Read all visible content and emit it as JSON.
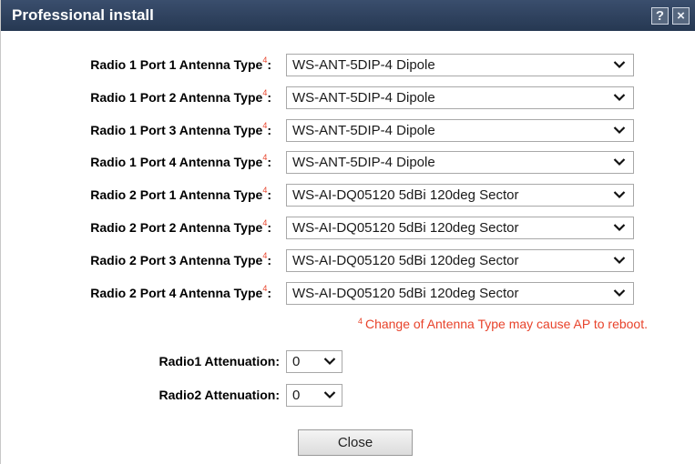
{
  "dialog": {
    "title": "Professional install",
    "help_glyph": "?",
    "close_glyph": "×"
  },
  "antenna_rows": [
    {
      "label": "Radio 1 Port 1 Antenna Type",
      "value": "WS-ANT-5DIP-4 Dipole"
    },
    {
      "label": "Radio 1 Port 2 Antenna Type",
      "value": "WS-ANT-5DIP-4 Dipole"
    },
    {
      "label": "Radio 1 Port 3 Antenna Type",
      "value": "WS-ANT-5DIP-4 Dipole"
    },
    {
      "label": "Radio 1 Port 4 Antenna Type",
      "value": "WS-ANT-5DIP-4 Dipole"
    },
    {
      "label": "Radio 2 Port 1 Antenna Type",
      "value": "WS-AI-DQ05120 5dBi 120deg Sector"
    },
    {
      "label": "Radio 2 Port 2 Antenna Type",
      "value": "WS-AI-DQ05120 5dBi 120deg Sector"
    },
    {
      "label": "Radio 2 Port 3 Antenna Type",
      "value": "WS-AI-DQ05120 5dBi 120deg Sector"
    },
    {
      "label": "Radio 2 Port 4 Antenna Type",
      "value": "WS-AI-DQ05120 5dBi 120deg Sector"
    }
  ],
  "footnote_marker": "4",
  "label_colon": ":",
  "note": "Change of Antenna Type may cause AP to reboot.",
  "attenuation": [
    {
      "label": "Radio1 Attenuation:",
      "value": "0"
    },
    {
      "label": "Radio2 Attenuation:",
      "value": "0"
    }
  ],
  "close_label": "Close",
  "colors": {
    "title_bar": "#263852",
    "footnote": "#e8432b"
  },
  "icons": {
    "help": "help-icon",
    "close": "close-icon",
    "dropdown": "chevron-down-icon"
  }
}
